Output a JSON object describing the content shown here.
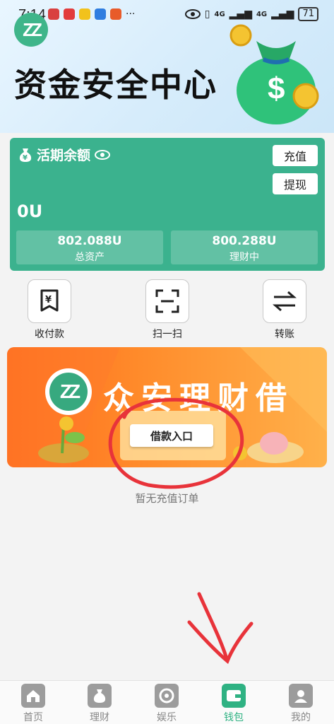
{
  "status": {
    "time": "7:14",
    "signal_1": "4G",
    "signal_2": "4G",
    "battery": "71"
  },
  "header": {
    "logo_text": "ZZ",
    "title": "资金安全中心"
  },
  "balance": {
    "label": "活期余额",
    "amount": "0U",
    "recharge_label": "充值",
    "withdraw_label": "提现",
    "total_value": "802.088U",
    "total_label": "总资产",
    "invest_value": "800.288U",
    "invest_label": "理财中"
  },
  "actions": [
    {
      "label": "收付款",
      "icon": "receipt-yuan-icon"
    },
    {
      "label": "扫一扫",
      "icon": "scan-icon"
    },
    {
      "label": "转账",
      "icon": "transfer-icon"
    }
  ],
  "banner": {
    "logo_text": "ZZ",
    "title": "众安理财借",
    "button_label": "借款入口"
  },
  "empty_text": "暂无充值订单",
  "tabs": [
    {
      "label": "首页",
      "icon": "home-icon",
      "active": false
    },
    {
      "label": "理财",
      "icon": "money-bag-icon",
      "active": false
    },
    {
      "label": "娱乐",
      "icon": "game-icon",
      "active": false
    },
    {
      "label": "钱包",
      "icon": "wallet-icon",
      "active": true
    },
    {
      "label": "我的",
      "icon": "user-icon",
      "active": false
    }
  ],
  "colors": {
    "brand_green": "#3bb28e",
    "banner_orange": "#ff7a22",
    "annotation_red": "#e8333a"
  }
}
